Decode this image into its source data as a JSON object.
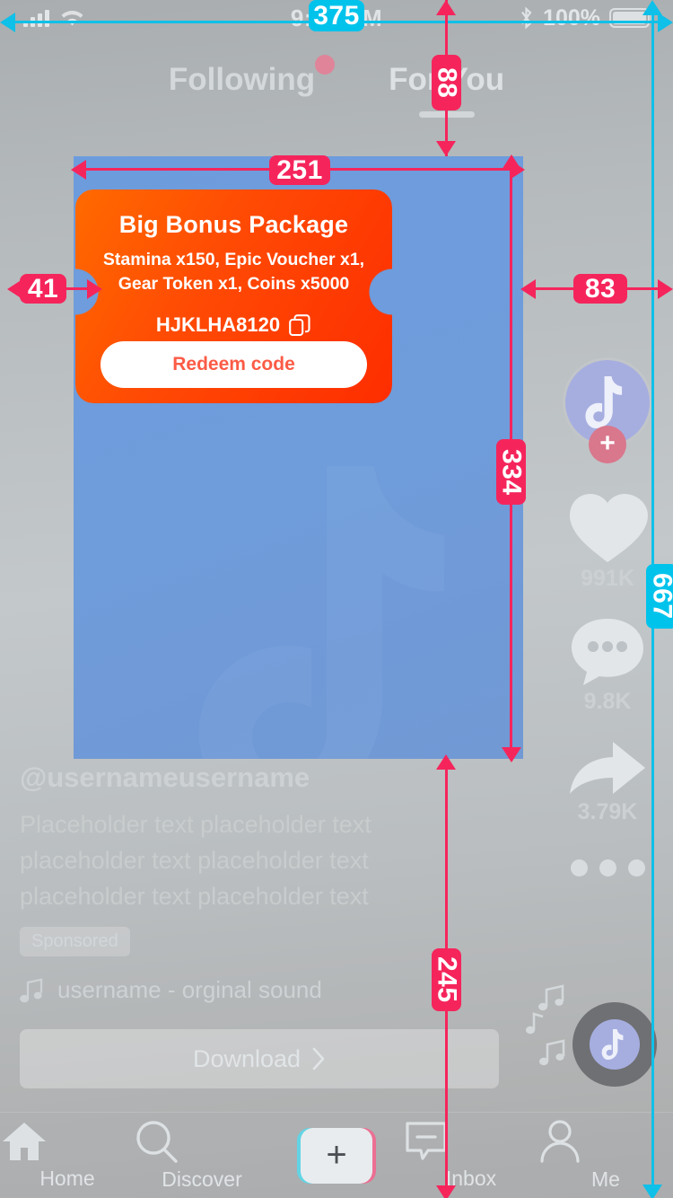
{
  "status_bar": {
    "time": "9:41 AM",
    "battery_percent": "100%",
    "signal_icon": "signal-bars-icon",
    "wifi_icon": "wifi-icon",
    "bluetooth_icon": "bluetooth-icon",
    "battery_icon": "battery-full-icon"
  },
  "top_tabs": {
    "following": "Following",
    "for_you": "For You",
    "active": "For You"
  },
  "coupon": {
    "title": "Big Bonus Package",
    "description": "Stamina x150, Epic Voucher x1, Gear Token x1, Coins x5000",
    "code": "HJKLHA8120",
    "copy_icon": "copy-icon",
    "button_label": "Redeem code",
    "bg_color_start": "#ff6a00",
    "bg_color_end": "#fe2d00",
    "button_text_color": "#fc5b46"
  },
  "video": {
    "background_color": "#6d9cdd",
    "watermark_icon": "tiktok-note-watermark"
  },
  "caption": {
    "handle": "@usernameusername",
    "body": "Placeholder text placeholder text placeholder text placeholder text placeholder text placeholder text",
    "sponsored_label": "Sponsored",
    "music_icon": "music-note-icon",
    "sound_label": "username - orginal sound"
  },
  "download_cta": {
    "label": "Download",
    "chevron_icon": "chevron-right-icon"
  },
  "right_rail": {
    "avatar_icon": "tiktok-avatar",
    "follow_icon": "plus-icon",
    "like": {
      "icon": "heart-icon",
      "count": "991K"
    },
    "comment": {
      "icon": "comment-bubble-icon",
      "count": "9.8K"
    },
    "share": {
      "icon": "share-arrow-icon",
      "count": "3.79K"
    },
    "more": {
      "icon": "three-dots-icon"
    },
    "disc_icon": "music-disc-icon"
  },
  "bottom_nav": {
    "items": [
      {
        "label": "Home",
        "icon": "home-icon"
      },
      {
        "label": "Discover",
        "icon": "search-icon"
      },
      {
        "label": "",
        "icon": "plus-create-icon"
      },
      {
        "label": "Inbox",
        "icon": "inbox-icon"
      },
      {
        "label": "Me",
        "icon": "person-icon"
      }
    ]
  },
  "measurements": {
    "screen_width": "375",
    "top_offset": "88",
    "card_width": "251",
    "left_margin": "41",
    "right_margin": "83",
    "card_height": "334",
    "bottom_offset": "245",
    "screen_height": "667",
    "pink_color": "#f5255c",
    "cyan_color": "#00c3ec"
  }
}
